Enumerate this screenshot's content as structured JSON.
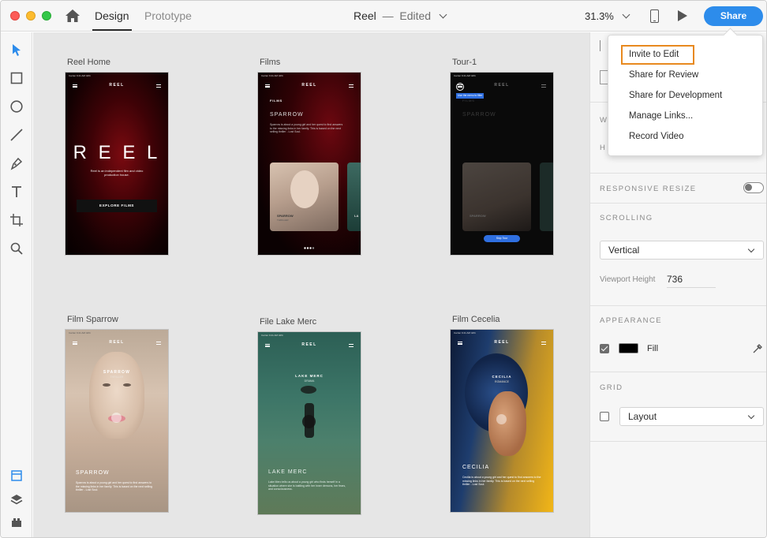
{
  "titlebar": {
    "tabs": [
      "Design",
      "Prototype"
    ],
    "doc_name": "Reel",
    "separator": "—",
    "doc_status": "Edited",
    "zoom": "31.3%",
    "share_label": "Share"
  },
  "share_menu": {
    "items": [
      "Invite to Edit",
      "Share for Review",
      "Share for Development",
      "Manage Links...",
      "Record Video"
    ],
    "highlighted_item": "Invite to Edit",
    "highlight_color": "#e8891f"
  },
  "toolbar": {
    "tools": [
      "select-icon",
      "rectangle-icon",
      "ellipse-icon",
      "line-icon",
      "pen-icon",
      "text-icon",
      "artboard-icon",
      "zoom-icon"
    ],
    "bottom_tools": [
      "assets-icon",
      "layers-icon",
      "plugins-icon"
    ]
  },
  "artboards": [
    {
      "label": "Reel Home",
      "bg": "#1a0305",
      "brand": "REEL",
      "big_text": "R E E L",
      "tagline": "Reel is an independent film and video production house.",
      "cta": "EXPLORE FILMS",
      "status": "Carrier   9:41 AM   42%"
    },
    {
      "label": "Films",
      "bg": "#120204",
      "brand": "REEL",
      "heading": "FILMS",
      "title": "SPARROW",
      "desc": "Sparrow is about a young girl and her quest to find answers to the missing links in her family. This is based on the next selling thriller - Lost Soul.",
      "card_title": "SPARROW",
      "card_sub": "THRILLER",
      "next_card": "LA",
      "status": "Carrier   9:41 AM   42%"
    },
    {
      "label": "Tour-1",
      "bg": "#0c0c0c",
      "brand": "REEL",
      "tooltip": "Use the menu to filter",
      "heading": "FILMS",
      "title": "SPARROW",
      "card_title": "SPARROW",
      "cta": "Skip Tour",
      "status": "Carrier   9:41 AM   42%"
    },
    {
      "label": "Film Sparrow",
      "bg": "#c9b9a8",
      "brand": "REEL",
      "title": "SPARROW",
      "sub": "THRILLER",
      "bottom_title": "SPARROW",
      "desc": "Sparrow is about a young girl and her quest to find answers to the missing links in her family. This is based on the next selling thriller - Lost Soul.",
      "status": "Carrier   9:41 AM   42%"
    },
    {
      "label": "File Lake Merc",
      "bg": "#2f5a4e",
      "brand": "REEL",
      "title": "LAKE MERC",
      "sub": "DRAMA",
      "bottom_title": "LAKE MERC",
      "desc": "Lake Merc tells us about a young girl who finds herself in a situation where she is battling with her inner demons, her fears, and consciousness.",
      "status": "Carrier   9:41 AM   42%"
    },
    {
      "label": "Film Cecelia",
      "bg": "#1b2a4a",
      "brand": "REEL",
      "title": "CECILIA",
      "sub": "ROMANCE",
      "bottom_title": "CECILIA",
      "desc": "Cecilia is about a young girl and her quest to find answers to the missing links in her family. This is based on the next selling thriller - Lost Soul.",
      "status": "Carrier   9:41 AM   42%"
    }
  ],
  "panel": {
    "w_label": "W",
    "h_label": "H",
    "responsive_resize": "RESPONSIVE RESIZE",
    "responsive_on": false,
    "scrolling_title": "SCROLLING",
    "scrolling_value": "Vertical",
    "viewport_label": "Viewport Height",
    "viewport_value": "736",
    "appearance_title": "APPEARANCE",
    "fill_checked": true,
    "fill_label": "Fill",
    "fill_color": "#000000",
    "grid_title": "GRID",
    "grid_checked": false,
    "grid_value": "Layout"
  },
  "colors": {
    "accent": "#2d8ceb",
    "canvas": "#e6e6e6",
    "tour_button": "#2f6fe0"
  }
}
